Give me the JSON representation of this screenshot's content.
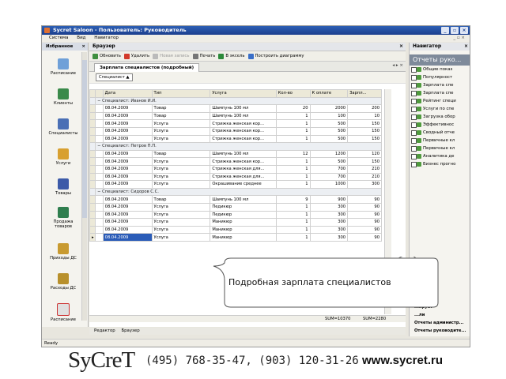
{
  "window": {
    "title": "Sycret Saloon - Пользователь: Руководитель",
    "menu": [
      "Система",
      "Вид",
      "Навигатор"
    ],
    "menu_right": "_ ▫ ×"
  },
  "left_panel": {
    "title": "Избранное",
    "items": [
      "Расписание",
      "Клиенты",
      "Специалисты",
      "Услуги",
      "Товары",
      "Продажа товаров",
      "Приходы ДС",
      "Расходы ДС",
      "Расписание"
    ]
  },
  "browser": {
    "title": "Браузер",
    "toolbar": {
      "refresh": "Обновить",
      "delete": "Удалить",
      "new_record": "Новая запись",
      "print": "Печать",
      "excel": "В эксель",
      "chart": "Построить диаграмму"
    },
    "tab_title": "Зарплата специалистов (подробный)",
    "tab_controls": "◂ ▸ ×",
    "group_chip": "Специалист ▲",
    "columns": [
      "Дата",
      "Тип",
      "Услуга",
      "Кол-во",
      "К оплате",
      "Зарпл..."
    ],
    "groups": [
      {
        "label": "− Специалист: Иванов И.И.",
        "rows": [
          [
            "08.04.2009",
            "Товар",
            "Шампунь 100 мл",
            "20",
            "2000",
            "200"
          ],
          [
            "08.04.2009",
            "Товар",
            "Шампунь 100 мл",
            "1",
            "100",
            "10"
          ],
          [
            "08.04.2009",
            "Услуга",
            "Стрижка женская кор...",
            "1",
            "500",
            "150"
          ],
          [
            "08.04.2009",
            "Услуга",
            "Стрижка женская кор...",
            "1",
            "500",
            "150"
          ],
          [
            "08.04.2009",
            "Услуга",
            "Стрижка женская кор...",
            "1",
            "500",
            "150"
          ]
        ]
      },
      {
        "label": "− Специалист: Петров П.П.",
        "rows": [
          [
            "08.04.2009",
            "Товар",
            "Шампунь 100 мл",
            "12",
            "1200",
            "120"
          ],
          [
            "08.04.2009",
            "Услуга",
            "Стрижка женская кор...",
            "1",
            "500",
            "150"
          ],
          [
            "08.04.2009",
            "Услуга",
            "Стрижка женская для...",
            "1",
            "700",
            "210"
          ],
          [
            "08.04.2009",
            "Услуга",
            "Стрижка женская для...",
            "1",
            "700",
            "210"
          ],
          [
            "08.04.2009",
            "Услуга",
            "Окрашивание среднее",
            "1",
            "1000",
            "300"
          ]
        ]
      },
      {
        "label": "− Специалист: Сидоров С.С.",
        "rows": [
          [
            "08.04.2009",
            "Товар",
            "Шампунь 100 мл",
            "9",
            "900",
            "90"
          ],
          [
            "08.04.2009",
            "Услуга",
            "Педикюр",
            "1",
            "300",
            "90"
          ],
          [
            "08.04.2009",
            "Услуга",
            "Педикюр",
            "1",
            "300",
            "90"
          ],
          [
            "08.04.2009",
            "Услуга",
            "Маникюр",
            "1",
            "300",
            "90"
          ],
          [
            "08.04.2009",
            "Услуга",
            "Маникюр",
            "1",
            "300",
            "90"
          ],
          [
            "08.04.2009",
            "Услуга",
            "Маникюр",
            "1",
            "300",
            "90"
          ]
        ]
      }
    ],
    "sum_qty": "SUM=10370",
    "sum_pay": "SUM=2280",
    "bottom_tabs": [
      "Редактор",
      "Браузер"
    ]
  },
  "status": "Ready",
  "navigator": {
    "title": "Навигатор",
    "section": "Отчеты руко...",
    "items": [
      "Общие показ",
      "Популярност",
      "Зарплата спе",
      "Зарплата спе",
      "Рейтинг специ",
      "Услуги по спе",
      "Загрузка обор",
      "Эффективнос",
      "Сводный отче",
      "Первичные кл",
      "Первичные кл",
      "Аналитика де",
      "Бизнес прогно"
    ],
    "lower": [
      "...ние",
      "...ирует",
      "...ли",
      "Отчеты администр...",
      "Отчеты руководите..."
    ]
  },
  "callout_text": "Подробная зарплата специалистов",
  "footer": {
    "logo": "SyCreT",
    "phone": "(495) 768-35-47, (903) 120-31-26",
    "url": "www.sycret.ru"
  }
}
